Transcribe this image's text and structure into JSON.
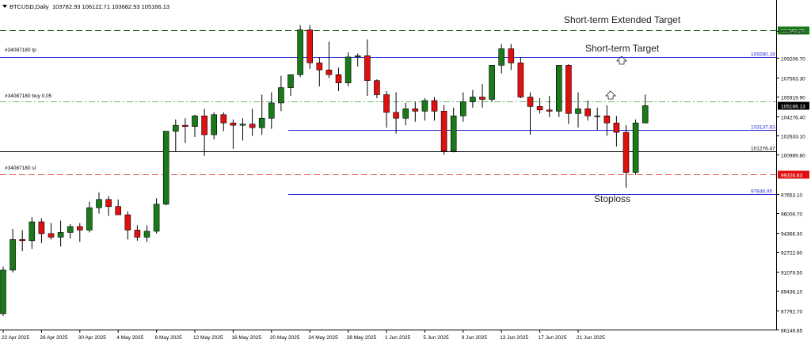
{
  "header": {
    "symbol_label": "BTCUSD,Daily",
    "ohlc_text": "103782.93 106122.71 103682.93 105166.13"
  },
  "colors": {
    "bull": "#1a7a1a",
    "bear": "#e01010",
    "wick": "#000000",
    "grid": "#000000",
    "blue_line": "#2b2bd6",
    "red_dashed": "#e05a5a",
    "green_dashdot": "#6ab86a",
    "green_dashed": "#2c6b2c",
    "price_tag_black": "#000000",
    "price_tag_red": "#e01010",
    "price_tag_blue_text": "#2b2bd6",
    "price_tag_green_bg": "#1a7a1a"
  },
  "annotations": {
    "extended_target": "Short-term Extended Target",
    "target": "Short-term Target",
    "stoploss": "Stoploss",
    "tp_label": "#34087180 tp",
    "buy_label": "#34087180 buy 0.05",
    "sl_label": "#34087180 sl"
  },
  "chart_data": {
    "type": "candlestick",
    "title": "BTCUSD,Daily",
    "ylim": [
      86149.85,
      113200
    ],
    "y_ticks": [
      "111543.30",
      "109206.70",
      "107563.30",
      "105919.90",
      "104276.40",
      "102633.10",
      "100989.80",
      "97653.10",
      "96009.70",
      "94366.30",
      "92722.90",
      "91079.50",
      "89436.10",
      "87792.70",
      "86149.85"
    ],
    "x_tick_labels": [
      "22 Apr 2025",
      "26 Apr 2025",
      "30 Apr 2025",
      "4 May 2025",
      "8 May 2025",
      "12 May 2025",
      "16 May 2025",
      "20 May 2025",
      "24 May 2025",
      "28 May 2025",
      "1 Jun 2025",
      "5 Jun 2025",
      "9 Jun 2025",
      "13 Jun 2025",
      "17 Jun 2025",
      "21 Jun 2025"
    ],
    "x_tick_index": [
      0,
      4,
      8,
      12,
      16,
      20,
      24,
      28,
      32,
      36,
      40,
      44,
      48,
      52,
      56,
      60
    ],
    "candles": [
      {
        "o": 87500,
        "h": 91500,
        "l": 87300,
        "c": 91200
      },
      {
        "o": 91200,
        "h": 94700,
        "l": 91000,
        "c": 93800
      },
      {
        "o": 93800,
        "h": 94600,
        "l": 92800,
        "c": 93700
      },
      {
        "o": 93700,
        "h": 95700,
        "l": 93000,
        "c": 95300
      },
      {
        "o": 95300,
        "h": 95600,
        "l": 93500,
        "c": 94300
      },
      {
        "o": 94300,
        "h": 95200,
        "l": 93800,
        "c": 94000
      },
      {
        "o": 94000,
        "h": 95400,
        "l": 93200,
        "c": 94400
      },
      {
        "o": 94400,
        "h": 95100,
        "l": 93900,
        "c": 94900
      },
      {
        "o": 94900,
        "h": 95200,
        "l": 93600,
        "c": 94600
      },
      {
        "o": 94600,
        "h": 97000,
        "l": 94400,
        "c": 96500
      },
      {
        "o": 96500,
        "h": 97800,
        "l": 96000,
        "c": 97200
      },
      {
        "o": 97200,
        "h": 97500,
        "l": 95800,
        "c": 96600
      },
      {
        "o": 96600,
        "h": 97200,
        "l": 95900,
        "c": 95900
      },
      {
        "o": 95900,
        "h": 96200,
        "l": 93800,
        "c": 94600
      },
      {
        "o": 94600,
        "h": 95000,
        "l": 93700,
        "c": 94000
      },
      {
        "o": 94000,
        "h": 95000,
        "l": 93600,
        "c": 94500
      },
      {
        "o": 94500,
        "h": 97300,
        "l": 94300,
        "c": 96800
      },
      {
        "o": 96800,
        "h": 103000,
        "l": 96700,
        "c": 103000
      },
      {
        "o": 103000,
        "h": 104000,
        "l": 101300,
        "c": 103500
      },
      {
        "o": 103500,
        "h": 104100,
        "l": 102000,
        "c": 103400
      },
      {
        "o": 103400,
        "h": 104400,
        "l": 102500,
        "c": 104300
      },
      {
        "o": 104300,
        "h": 104900,
        "l": 100900,
        "c": 102700
      },
      {
        "o": 102700,
        "h": 104600,
        "l": 102300,
        "c": 104400
      },
      {
        "o": 104400,
        "h": 104600,
        "l": 103000,
        "c": 103700
      },
      {
        "o": 103700,
        "h": 104000,
        "l": 101500,
        "c": 103500
      },
      {
        "o": 103500,
        "h": 104100,
        "l": 102200,
        "c": 103600
      },
      {
        "o": 103600,
        "h": 104900,
        "l": 102600,
        "c": 103300
      },
      {
        "o": 103300,
        "h": 106100,
        "l": 102700,
        "c": 104100
      },
      {
        "o": 104100,
        "h": 106300,
        "l": 103200,
        "c": 105400
      },
      {
        "o": 105400,
        "h": 107700,
        "l": 104700,
        "c": 106700
      },
      {
        "o": 106700,
        "h": 107700,
        "l": 106000,
        "c": 107800
      },
      {
        "o": 107800,
        "h": 112000,
        "l": 107600,
        "c": 111600
      },
      {
        "o": 111600,
        "h": 112000,
        "l": 108300,
        "c": 108800
      },
      {
        "o": 108800,
        "h": 109300,
        "l": 106800,
        "c": 108200
      },
      {
        "o": 108200,
        "h": 110600,
        "l": 107500,
        "c": 107800
      },
      {
        "o": 107800,
        "h": 108400,
        "l": 106400,
        "c": 107100
      },
      {
        "o": 107100,
        "h": 109700,
        "l": 106800,
        "c": 109300
      },
      {
        "o": 109300,
        "h": 109600,
        "l": 108500,
        "c": 109400
      },
      {
        "o": 109400,
        "h": 110800,
        "l": 106000,
        "c": 107300
      },
      {
        "o": 107300,
        "h": 107400,
        "l": 105800,
        "c": 106100
      },
      {
        "o": 106100,
        "h": 106400,
        "l": 103300,
        "c": 104600
      },
      {
        "o": 104600,
        "h": 106300,
        "l": 102800,
        "c": 104100
      },
      {
        "o": 104100,
        "h": 105400,
        "l": 103500,
        "c": 104900
      },
      {
        "o": 104900,
        "h": 105500,
        "l": 103800,
        "c": 104700
      },
      {
        "o": 104700,
        "h": 105800,
        "l": 103900,
        "c": 105600
      },
      {
        "o": 105600,
        "h": 105900,
        "l": 103900,
        "c": 104700
      },
      {
        "o": 104700,
        "h": 105200,
        "l": 101000,
        "c": 101300
      },
      {
        "o": 101300,
        "h": 105000,
        "l": 101200,
        "c": 104300
      },
      {
        "o": 104300,
        "h": 106300,
        "l": 103800,
        "c": 105500
      },
      {
        "o": 105500,
        "h": 106500,
        "l": 105000,
        "c": 105900
      },
      {
        "o": 105900,
        "h": 107000,
        "l": 105000,
        "c": 105700
      },
      {
        "o": 105700,
        "h": 108600,
        "l": 105500,
        "c": 108600
      },
      {
        "o": 108600,
        "h": 110400,
        "l": 107900,
        "c": 110000
      },
      {
        "o": 110000,
        "h": 110400,
        "l": 108200,
        "c": 108800
      },
      {
        "o": 108800,
        "h": 109300,
        "l": 105800,
        "c": 105900
      },
      {
        "o": 105900,
        "h": 106300,
        "l": 102700,
        "c": 105100
      },
      {
        "o": 105100,
        "h": 105800,
        "l": 104500,
        "c": 104800
      },
      {
        "o": 104800,
        "h": 106000,
        "l": 104200,
        "c": 104700
      },
      {
        "o": 104700,
        "h": 108600,
        "l": 104200,
        "c": 108600
      },
      {
        "o": 108600,
        "h": 108700,
        "l": 103600,
        "c": 104500
      },
      {
        "o": 104500,
        "h": 106300,
        "l": 103300,
        "c": 104900
      },
      {
        "o": 104900,
        "h": 105600,
        "l": 103900,
        "c": 104300
      },
      {
        "o": 104300,
        "h": 105000,
        "l": 103100,
        "c": 104300
      },
      {
        "o": 104300,
        "h": 105200,
        "l": 102600,
        "c": 103700
      },
      {
        "o": 103700,
        "h": 104300,
        "l": 101700,
        "c": 102900
      },
      {
        "o": 102900,
        "h": 103500,
        "l": 98200,
        "c": 99500
      },
      {
        "o": 99500,
        "h": 104000,
        "l": 99300,
        "c": 103700
      },
      {
        "o": 103700,
        "h": 106100,
        "l": 103700,
        "c": 105166
      }
    ],
    "levels": [
      {
        "name": "extended-target",
        "value": 111569.29,
        "label": "111569.29",
        "style": "dashed-green"
      },
      {
        "name": "tp",
        "value": 109280.18,
        "label": "109280.18",
        "style": "solid-blue"
      },
      {
        "name": "buy",
        "value": 105500,
        "label": "",
        "style": "dashdot-green"
      },
      {
        "name": "current",
        "value": 105166.13,
        "label": "105166.13",
        "style": "tag-black"
      },
      {
        "name": "level-103137",
        "value": 103137.83,
        "label": "103137.83",
        "style": "solid-blue"
      },
      {
        "name": "level-101276",
        "value": 101276.47,
        "label": "101276.47",
        "style": "solid-black"
      },
      {
        "name": "sl",
        "value": 99326.83,
        "label": "99326.83",
        "style": "dashed-red"
      },
      {
        "name": "level-97646",
        "value": 97646.95,
        "label": "97646.95",
        "style": "solid-blue"
      }
    ]
  }
}
